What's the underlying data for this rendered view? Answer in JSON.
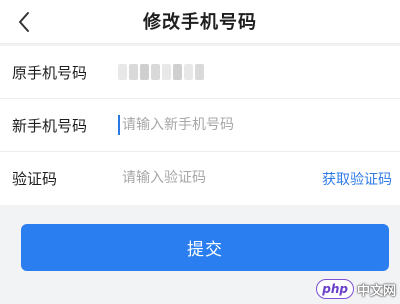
{
  "header": {
    "title": "修改手机号码",
    "back_icon": "chevron-left-icon"
  },
  "form": {
    "original_phone": {
      "label": "原手机号码",
      "value": ""
    },
    "new_phone": {
      "label": "新手机号码",
      "placeholder": "请输入新手机号码"
    },
    "verify_code": {
      "label": "验证码",
      "placeholder": "请输入验证码",
      "get_code_label": "获取验证码"
    }
  },
  "actions": {
    "submit_label": "提交"
  },
  "watermark": {
    "badge": "php",
    "site": "中文网"
  },
  "colors": {
    "accent": "#2a7ef0",
    "link": "#2f7be6",
    "background": "#f2f3f5"
  }
}
